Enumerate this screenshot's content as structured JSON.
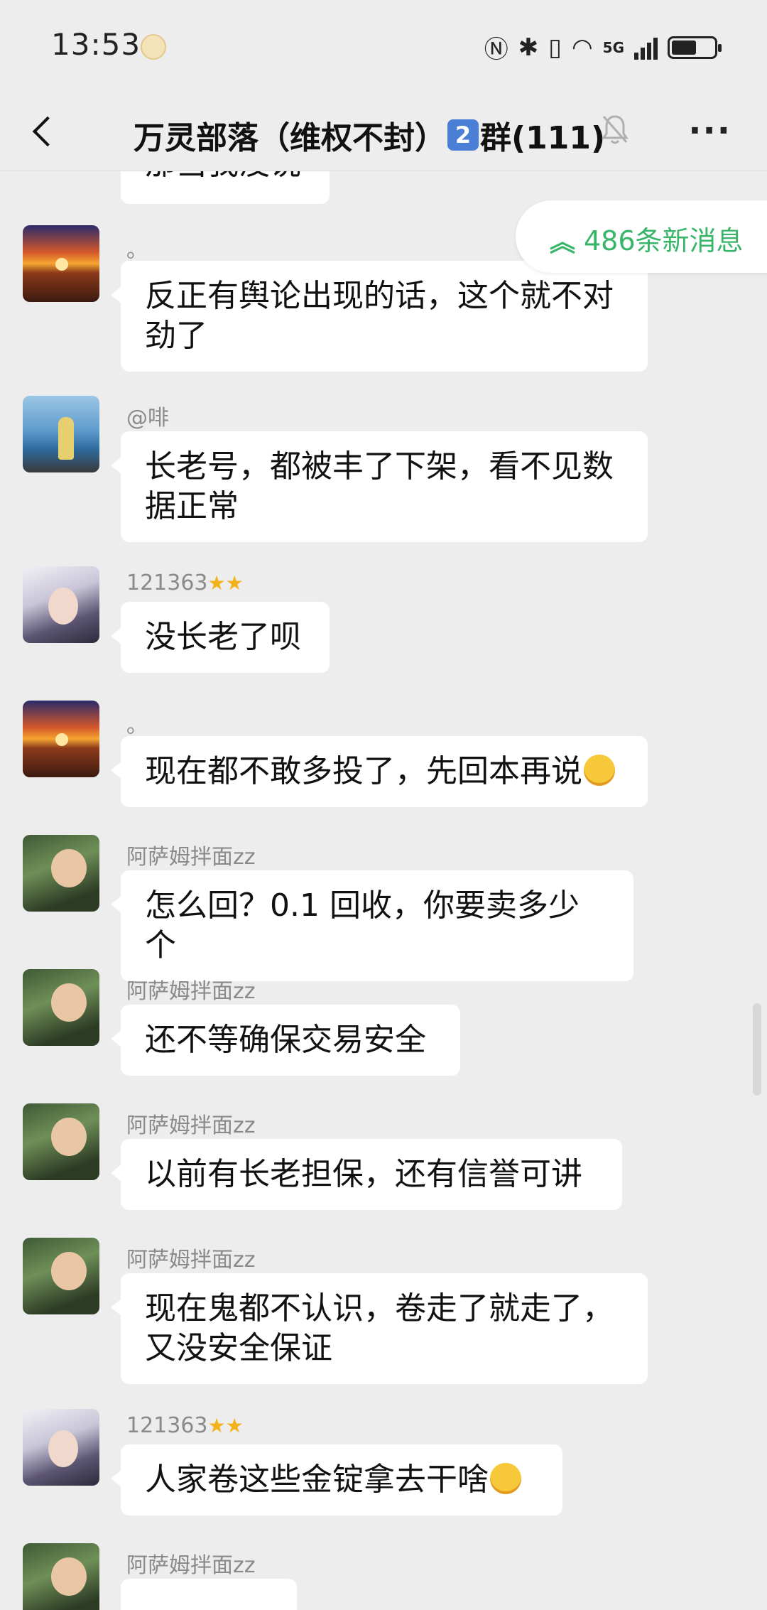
{
  "status_bar": {
    "time": "13:53",
    "network": "5G"
  },
  "header": {
    "title_prefix": "万灵部落（维权不封）",
    "title_badge": "2",
    "title_suffix": "群(111)"
  },
  "new_messages": {
    "label": "486条新消息"
  },
  "messages": [
    {
      "sender": "",
      "text": "那当我没说"
    },
    {
      "sender": "。",
      "text": "反正有舆论出现的话，这个就不对劲了"
    },
    {
      "sender": "@啡",
      "text": "长老号，都被丰了下架，看不见数据正常"
    },
    {
      "sender": "121363",
      "text": "没长老了呗"
    },
    {
      "sender": "。",
      "text": "现在都不敢多投了，先回本再说"
    },
    {
      "sender": "阿萨姆拌面zz",
      "text": "怎么回？0.1 回收，你要卖多少个"
    },
    {
      "sender": "阿萨姆拌面zz",
      "text": "还不等确保交易安全"
    },
    {
      "sender": "阿萨姆拌面zz",
      "text": "以前有长老担保，还有信誉可讲"
    },
    {
      "sender": "阿萨姆拌面zz",
      "text": "现在鬼都不认识，卷走了就走了，又没安全保证"
    },
    {
      "sender": "121363",
      "text": "人家卷这些金锭拿去干啥"
    },
    {
      "sender": "阿萨姆拌面zz",
      "text": ""
    }
  ],
  "icons": {
    "back": "chevron-left-icon",
    "mute": "bell-off-icon",
    "more": "more-horizontal-icon",
    "stars": "star-icon",
    "emoji_cry": "crying-emoji-icon",
    "emoji_laugh": "laughing-emoji-icon"
  },
  "colors": {
    "accent": "#39b56a",
    "background": "#ededed",
    "bubble": "#ffffff"
  }
}
